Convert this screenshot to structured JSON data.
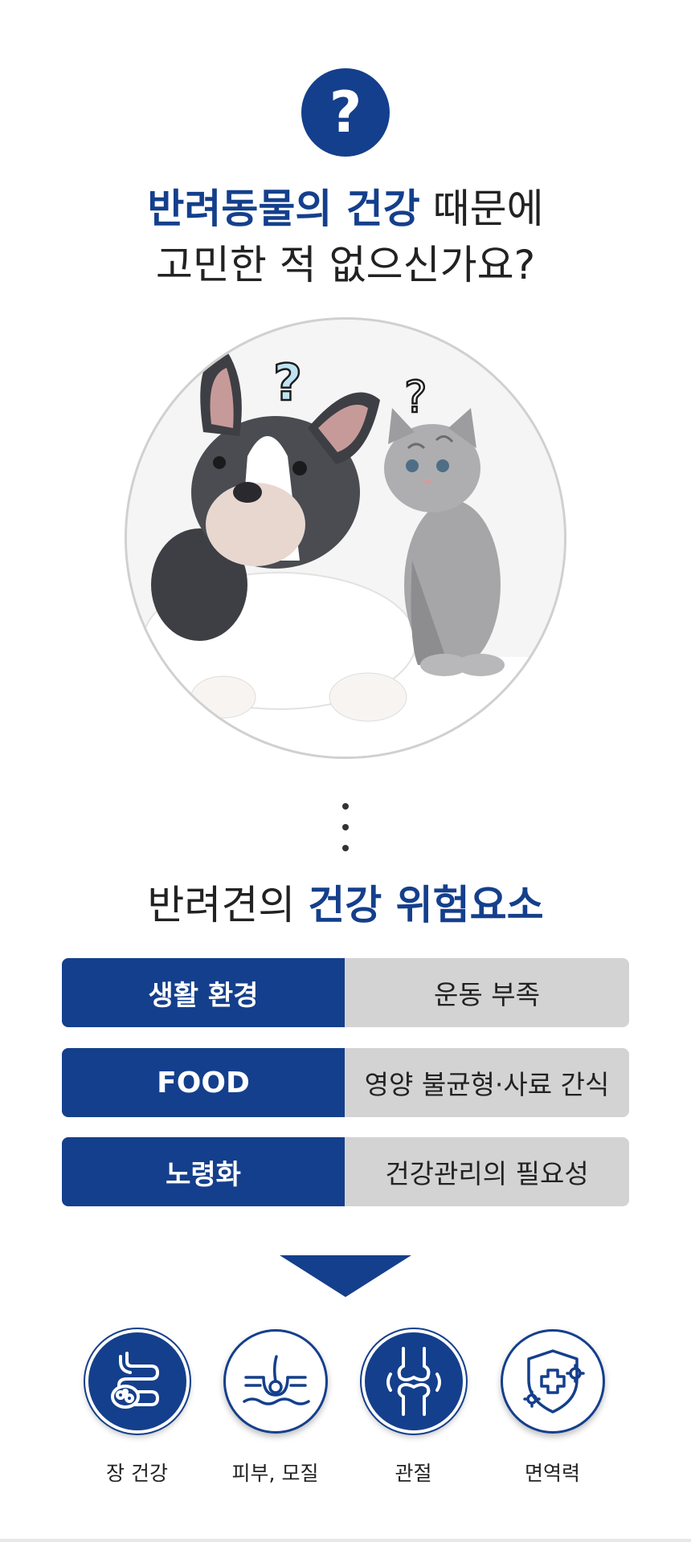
{
  "badge": {
    "symbol": "?"
  },
  "headline": {
    "line1_highlight": "반려동물의 건강",
    "line1_rest": " 때문에",
    "line2": "고민한 적 없으신가요?"
  },
  "photo": {
    "dog_question": "?",
    "cat_question": "?"
  },
  "risk_section": {
    "title_plain": "반려견의 ",
    "title_highlight": "건강 위험요소",
    "rows": [
      {
        "label": "생활 환경",
        "value": "운동 부족"
      },
      {
        "label": "FOOD",
        "value": "영양 불균형·사료 간식"
      },
      {
        "label": "노령화",
        "value": "건강관리의 필요성"
      }
    ]
  },
  "categories": [
    {
      "icon": "intestine-icon",
      "label": "장 건강"
    },
    {
      "icon": "skin-hair-icon",
      "label": "피부, 모질"
    },
    {
      "icon": "joint-icon",
      "label": "관절"
    },
    {
      "icon": "immune-shield-icon",
      "label": "면역력"
    }
  ],
  "colors": {
    "brand": "#143f8c",
    "gray_cell": "#d3d3d3"
  }
}
